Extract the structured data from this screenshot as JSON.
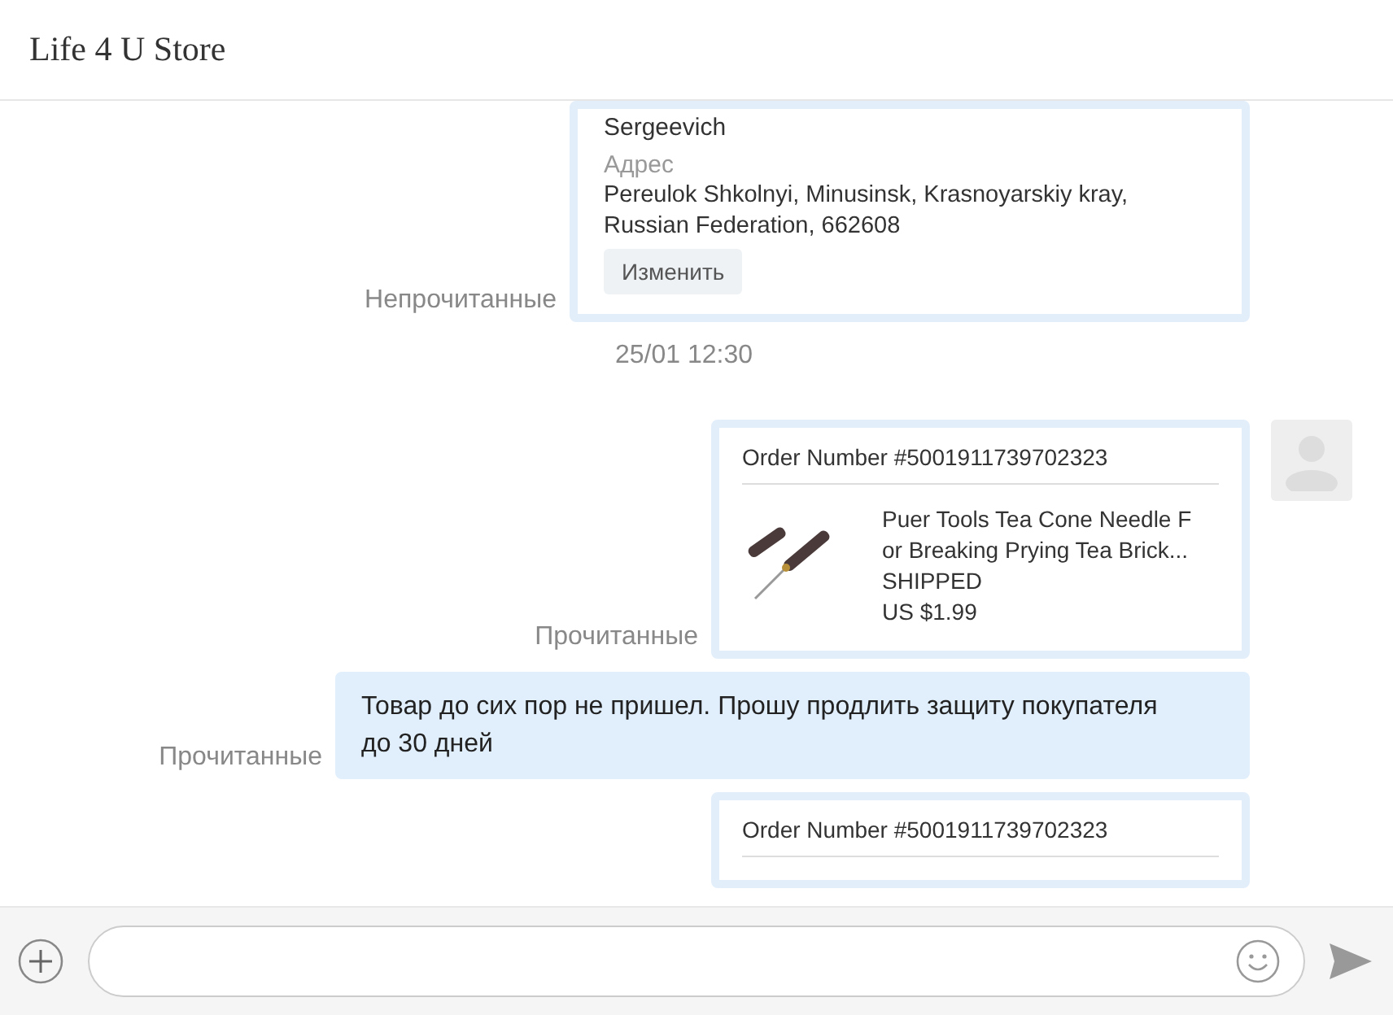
{
  "header": {
    "title": "Life 4 U Store"
  },
  "messages": [
    {
      "kind": "address_card",
      "status": "Непрочитанные",
      "avatar": false,
      "name": "Sergeevich",
      "address_label": "Адрес",
      "address": "Pereulok Shkolnyi, Minusinsk, Krasnoyarskiy kray, Russian Federation, 662608",
      "button": "Изменить"
    },
    {
      "kind": "timestamp",
      "text": "25/01 12:30"
    },
    {
      "kind": "order_card",
      "status": "Прочитанные",
      "avatar": true,
      "order": "Order Number #5001911739702323",
      "product": "Puer Tools Tea Cone Needle F or Breaking Prying Tea Brick...",
      "state": "SHIPPED",
      "price": "US $1.99"
    },
    {
      "kind": "text",
      "status": "Прочитанные",
      "avatar": false,
      "text": "Товар до сих пор не пришел. Прошу продлить защиту покупателя до 30 дней"
    },
    {
      "kind": "order_card",
      "avatar": false,
      "order": "Order Number #5001911739702323"
    }
  ]
}
